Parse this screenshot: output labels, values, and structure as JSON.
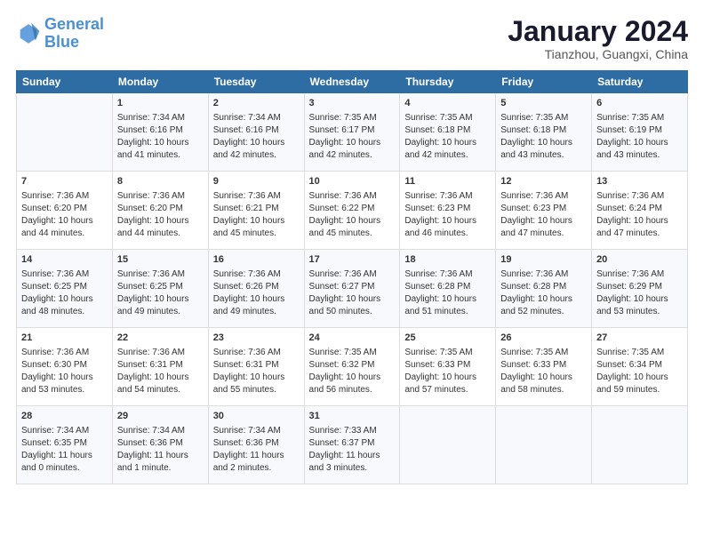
{
  "logo": {
    "text1": "General",
    "text2": "Blue"
  },
  "title": "January 2024",
  "subtitle": "Tianzhou, Guangxi, China",
  "headers": [
    "Sunday",
    "Monday",
    "Tuesday",
    "Wednesday",
    "Thursday",
    "Friday",
    "Saturday"
  ],
  "weeks": [
    [
      {
        "day": "",
        "info": ""
      },
      {
        "day": "1",
        "info": "Sunrise: 7:34 AM\nSunset: 6:16 PM\nDaylight: 10 hours\nand 41 minutes."
      },
      {
        "day": "2",
        "info": "Sunrise: 7:34 AM\nSunset: 6:16 PM\nDaylight: 10 hours\nand 42 minutes."
      },
      {
        "day": "3",
        "info": "Sunrise: 7:35 AM\nSunset: 6:17 PM\nDaylight: 10 hours\nand 42 minutes."
      },
      {
        "day": "4",
        "info": "Sunrise: 7:35 AM\nSunset: 6:18 PM\nDaylight: 10 hours\nand 42 minutes."
      },
      {
        "day": "5",
        "info": "Sunrise: 7:35 AM\nSunset: 6:18 PM\nDaylight: 10 hours\nand 43 minutes."
      },
      {
        "day": "6",
        "info": "Sunrise: 7:35 AM\nSunset: 6:19 PM\nDaylight: 10 hours\nand 43 minutes."
      }
    ],
    [
      {
        "day": "7",
        "info": "Sunrise: 7:36 AM\nSunset: 6:20 PM\nDaylight: 10 hours\nand 44 minutes."
      },
      {
        "day": "8",
        "info": "Sunrise: 7:36 AM\nSunset: 6:20 PM\nDaylight: 10 hours\nand 44 minutes."
      },
      {
        "day": "9",
        "info": "Sunrise: 7:36 AM\nSunset: 6:21 PM\nDaylight: 10 hours\nand 45 minutes."
      },
      {
        "day": "10",
        "info": "Sunrise: 7:36 AM\nSunset: 6:22 PM\nDaylight: 10 hours\nand 45 minutes."
      },
      {
        "day": "11",
        "info": "Sunrise: 7:36 AM\nSunset: 6:23 PM\nDaylight: 10 hours\nand 46 minutes."
      },
      {
        "day": "12",
        "info": "Sunrise: 7:36 AM\nSunset: 6:23 PM\nDaylight: 10 hours\nand 47 minutes."
      },
      {
        "day": "13",
        "info": "Sunrise: 7:36 AM\nSunset: 6:24 PM\nDaylight: 10 hours\nand 47 minutes."
      }
    ],
    [
      {
        "day": "14",
        "info": "Sunrise: 7:36 AM\nSunset: 6:25 PM\nDaylight: 10 hours\nand 48 minutes."
      },
      {
        "day": "15",
        "info": "Sunrise: 7:36 AM\nSunset: 6:25 PM\nDaylight: 10 hours\nand 49 minutes."
      },
      {
        "day": "16",
        "info": "Sunrise: 7:36 AM\nSunset: 6:26 PM\nDaylight: 10 hours\nand 49 minutes."
      },
      {
        "day": "17",
        "info": "Sunrise: 7:36 AM\nSunset: 6:27 PM\nDaylight: 10 hours\nand 50 minutes."
      },
      {
        "day": "18",
        "info": "Sunrise: 7:36 AM\nSunset: 6:28 PM\nDaylight: 10 hours\nand 51 minutes."
      },
      {
        "day": "19",
        "info": "Sunrise: 7:36 AM\nSunset: 6:28 PM\nDaylight: 10 hours\nand 52 minutes."
      },
      {
        "day": "20",
        "info": "Sunrise: 7:36 AM\nSunset: 6:29 PM\nDaylight: 10 hours\nand 53 minutes."
      }
    ],
    [
      {
        "day": "21",
        "info": "Sunrise: 7:36 AM\nSunset: 6:30 PM\nDaylight: 10 hours\nand 53 minutes."
      },
      {
        "day": "22",
        "info": "Sunrise: 7:36 AM\nSunset: 6:31 PM\nDaylight: 10 hours\nand 54 minutes."
      },
      {
        "day": "23",
        "info": "Sunrise: 7:36 AM\nSunset: 6:31 PM\nDaylight: 10 hours\nand 55 minutes."
      },
      {
        "day": "24",
        "info": "Sunrise: 7:35 AM\nSunset: 6:32 PM\nDaylight: 10 hours\nand 56 minutes."
      },
      {
        "day": "25",
        "info": "Sunrise: 7:35 AM\nSunset: 6:33 PM\nDaylight: 10 hours\nand 57 minutes."
      },
      {
        "day": "26",
        "info": "Sunrise: 7:35 AM\nSunset: 6:33 PM\nDaylight: 10 hours\nand 58 minutes."
      },
      {
        "day": "27",
        "info": "Sunrise: 7:35 AM\nSunset: 6:34 PM\nDaylight: 10 hours\nand 59 minutes."
      }
    ],
    [
      {
        "day": "28",
        "info": "Sunrise: 7:34 AM\nSunset: 6:35 PM\nDaylight: 11 hours\nand 0 minutes."
      },
      {
        "day": "29",
        "info": "Sunrise: 7:34 AM\nSunset: 6:36 PM\nDaylight: 11 hours\nand 1 minute."
      },
      {
        "day": "30",
        "info": "Sunrise: 7:34 AM\nSunset: 6:36 PM\nDaylight: 11 hours\nand 2 minutes."
      },
      {
        "day": "31",
        "info": "Sunrise: 7:33 AM\nSunset: 6:37 PM\nDaylight: 11 hours\nand 3 minutes."
      },
      {
        "day": "",
        "info": ""
      },
      {
        "day": "",
        "info": ""
      },
      {
        "day": "",
        "info": ""
      }
    ]
  ]
}
